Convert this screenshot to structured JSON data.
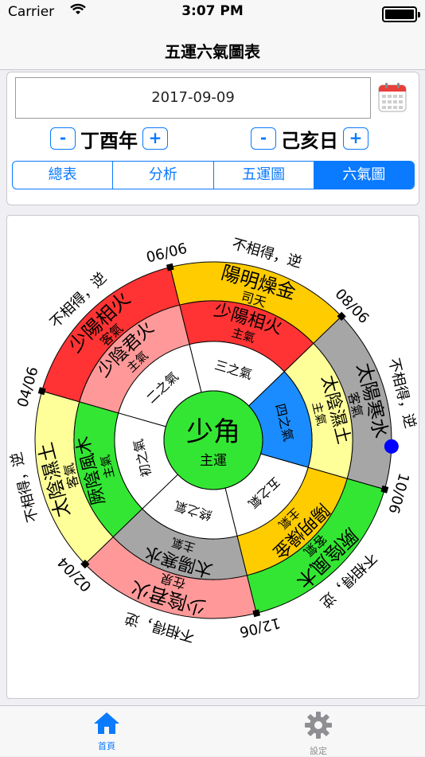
{
  "status": {
    "carrier": "Carrier",
    "time": "3:07 PM"
  },
  "nav": {
    "title": "五運六氣圖表"
  },
  "date": {
    "value": "2017-09-09"
  },
  "year_stepper": {
    "minus": "-",
    "label": "丁酉年",
    "plus": "+"
  },
  "day_stepper": {
    "minus": "-",
    "label": "己亥日",
    "plus": "+"
  },
  "segments": [
    {
      "label": "總表",
      "active": false
    },
    {
      "label": "分析",
      "active": false
    },
    {
      "label": "五運圖",
      "active": false
    },
    {
      "label": "六氣圖",
      "active": true
    }
  ],
  "center": {
    "main": "少角",
    "sub": "主運"
  },
  "outer_ring": [
    {
      "name": "陽明燥金",
      "role": "司天",
      "color": "#ffcc00"
    },
    {
      "name": "太陽寒水",
      "role": "客氣",
      "color": "#a6a6a6"
    },
    {
      "name": "厥陰風木",
      "role": "客氣",
      "color": "#33e633"
    },
    {
      "name": "少陰君火",
      "role": "在泉",
      "color": "#ff9999"
    },
    {
      "name": "太陰濕土",
      "role": "客氣",
      "color": "#ffff99"
    },
    {
      "name": "少陽相火",
      "role": "客氣",
      "color": "#ff3333"
    }
  ],
  "middle_ring": [
    {
      "name": "少陽相火",
      "role": "主氣",
      "color": "#ff3333"
    },
    {
      "name": "太陰濕土",
      "role": "主氣",
      "color": "#ffff99"
    },
    {
      "name": "陽明燥金",
      "role": "主氣",
      "color": "#ffcc00"
    },
    {
      "name": "太陽寒水",
      "role": "主氣",
      "color": "#a6a6a6"
    },
    {
      "name": "厥陰風木",
      "role": "主氣",
      "color": "#33e633"
    },
    {
      "name": "少陰君火",
      "role": "主氣",
      "color": "#ff9999"
    }
  ],
  "inner_ring": [
    {
      "label": "三之氣",
      "color": "#ffffff"
    },
    {
      "label": "四之氣",
      "color": "#1a8cff"
    },
    {
      "label": "五之氣",
      "color": "#ffffff"
    },
    {
      "label": "終之氣",
      "color": "#ffffff"
    },
    {
      "label": "初之氣",
      "color": "#ffffff"
    },
    {
      "label": "二之氣",
      "color": "#ffffff"
    }
  ],
  "dates": [
    "06/06",
    "08/06",
    "10/06",
    "12/06",
    "02/04",
    "04/06"
  ],
  "relations": [
    "不相得，逆",
    "不相得，逆",
    "不相得，逆",
    "不相得，逆",
    "不相得，逆",
    "不相得，逆"
  ],
  "current_marker_color": "#0000ff",
  "tabs": {
    "home": "首頁",
    "settings": "設定"
  }
}
